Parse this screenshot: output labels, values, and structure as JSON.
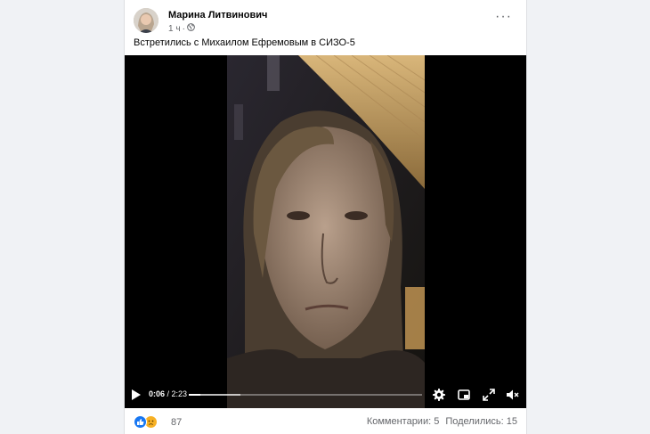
{
  "post": {
    "author": "Марина Литвинович",
    "time": "1 ч",
    "privacy_icon": "globe-icon",
    "text": "Встретились с Михаилом Ефремовым в СИЗО-5"
  },
  "video": {
    "current_time": "0:06",
    "duration": "/ 2:23",
    "progress_fraction": 0.05,
    "buffered_fraction": 0.22
  },
  "footer": {
    "reaction_icons": [
      "like-icon",
      "sad-icon"
    ],
    "reaction_count": "87",
    "comments": "Комментарии: 5",
    "shares": "Поделились: 15"
  },
  "colors": {
    "background": "#f0f2f5",
    "card": "#ffffff",
    "secondary_text": "#65676b",
    "like_blue": "#1877f2",
    "sad_yellow": "#f7b125"
  }
}
